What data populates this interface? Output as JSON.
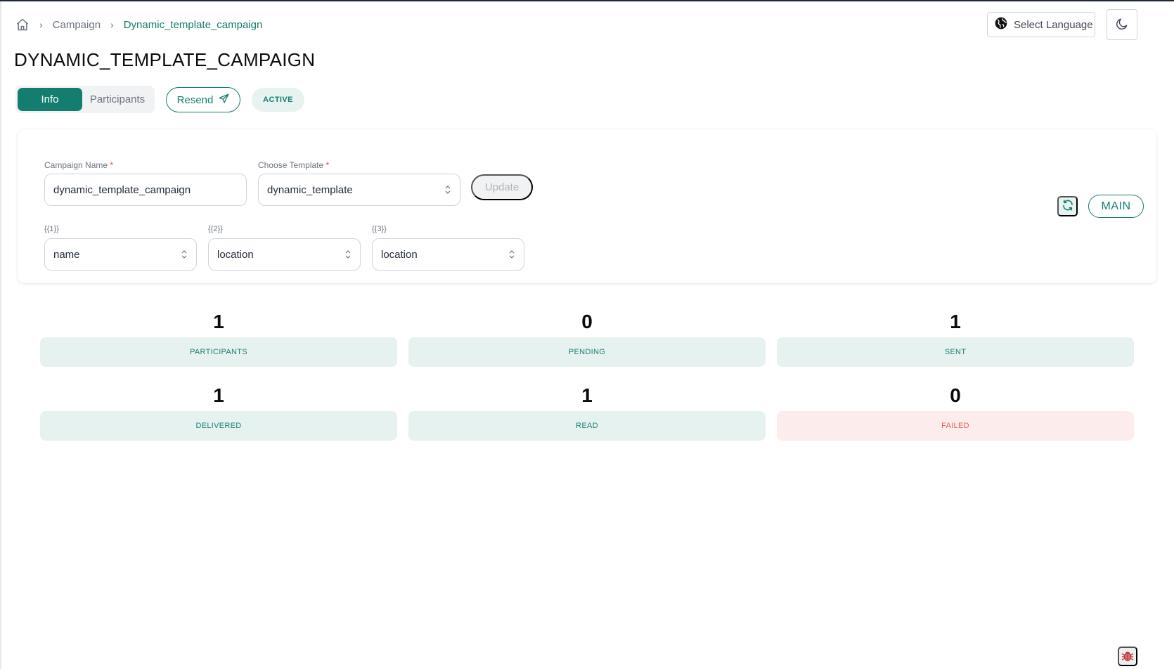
{
  "breadcrumb": {
    "home_icon": "home-icon",
    "items": [
      "Campaign",
      "Dynamic_template_campaign"
    ]
  },
  "header": {
    "title": "DYNAMIC_TEMPLATE_CAMPAIGN",
    "language_button": "Select Language",
    "language_icon": "globe-icon",
    "theme_icon": "moon-icon"
  },
  "tabs": [
    {
      "label": "Info",
      "active": true
    },
    {
      "label": "Participants",
      "active": false
    }
  ],
  "actions": {
    "resend_label": "Resend",
    "resend_icon": "send-icon",
    "status": "ACTIVE"
  },
  "form": {
    "campaign_name": {
      "label": "Campaign Name",
      "required_mark": "*",
      "value": "dynamic_template_campaign"
    },
    "template": {
      "label": "Choose Template",
      "required_mark": "*",
      "value": "dynamic_template"
    },
    "update_label": "Update",
    "variables": [
      {
        "label": "{{1}}",
        "value": "name"
      },
      {
        "label": "{{2}}",
        "value": "location"
      },
      {
        "label": "{{3}}",
        "value": "location"
      }
    ],
    "refresh_icon": "refresh-icon",
    "main_label": "MAIN"
  },
  "stats": [
    {
      "label": "PARTICIPANTS",
      "value": "1",
      "tone": "normal"
    },
    {
      "label": "PENDING",
      "value": "0",
      "tone": "normal"
    },
    {
      "label": "SENT",
      "value": "1",
      "tone": "normal"
    },
    {
      "label": "DELIVERED",
      "value": "1",
      "tone": "normal"
    },
    {
      "label": "READ",
      "value": "1",
      "tone": "normal"
    },
    {
      "label": "FAILED",
      "value": "0",
      "tone": "danger"
    }
  ],
  "debug_icon": "bug-icon",
  "colors": {
    "primary": "#137e70",
    "primary_soft": "#e6f2ef",
    "danger_soft": "#fdecec",
    "danger_text": "#ef5a5a"
  }
}
